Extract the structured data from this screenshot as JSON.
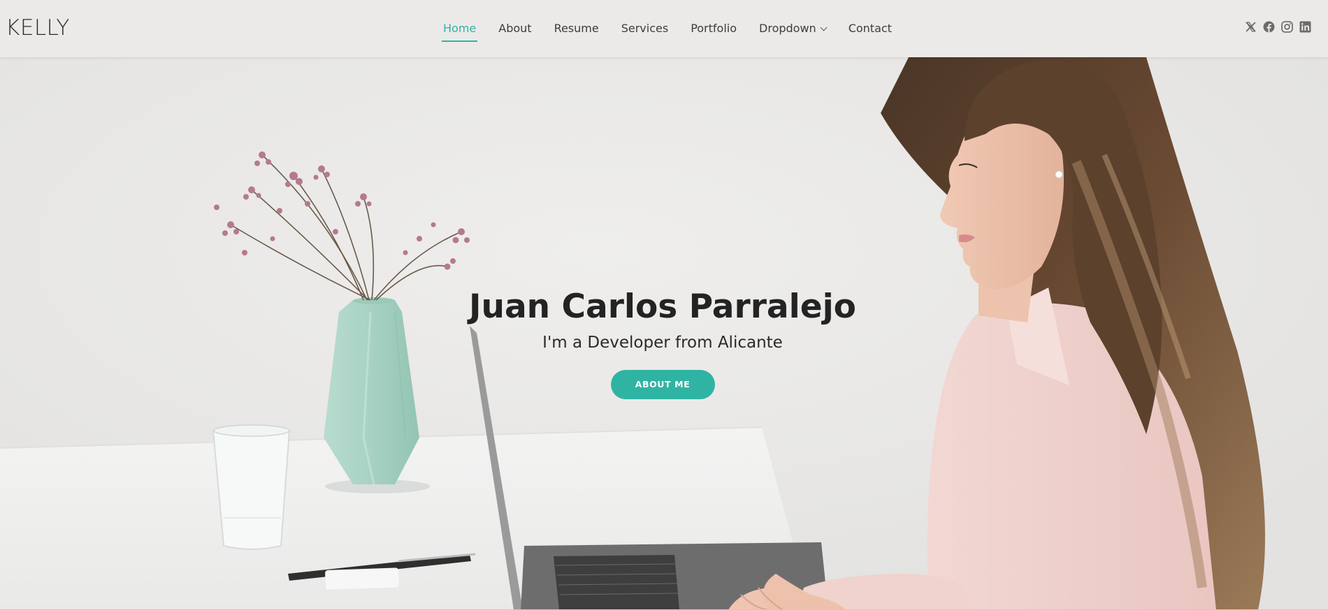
{
  "brand": {
    "logo_text": "KELLY"
  },
  "nav": {
    "items": [
      {
        "label": "Home",
        "active": true
      },
      {
        "label": "About",
        "active": false
      },
      {
        "label": "Resume",
        "active": false
      },
      {
        "label": "Services",
        "active": false
      },
      {
        "label": "Portfolio",
        "active": false
      },
      {
        "label": "Dropdown",
        "active": false,
        "has_submenu": true
      },
      {
        "label": "Contact",
        "active": false
      }
    ]
  },
  "socials": [
    {
      "icon": "x-twitter-icon"
    },
    {
      "icon": "facebook-icon"
    },
    {
      "icon": "instagram-icon"
    },
    {
      "icon": "linkedin-icon"
    }
  ],
  "hero": {
    "title": "Juan Carlos Parralejo",
    "subtitle": "I'm a Developer from Alicante",
    "button_label": "ABOUT ME",
    "background_image": "woman-working-on-laptop-at-desk-with-vase"
  },
  "colors": {
    "accent": "#2fb4a3",
    "text": "#232323",
    "header_bg": "#ebeae9"
  }
}
